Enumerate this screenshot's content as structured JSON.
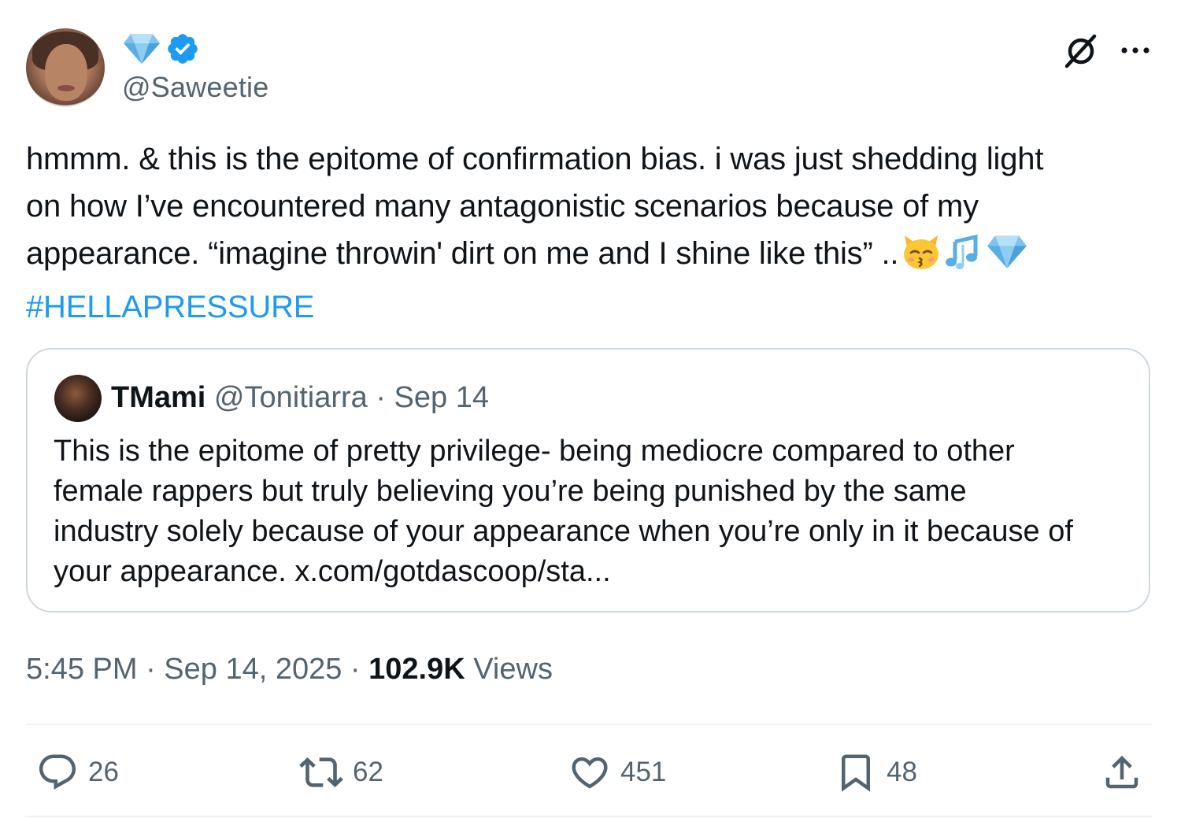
{
  "author": {
    "handle": "@Saweetie",
    "badges": [
      "diamond-icon",
      "verified-icon"
    ]
  },
  "tweet": {
    "lines": [
      "hmmm. & this is the epitome of confirmation bias. i was just shedding light",
      "on how I’ve encountered many antagonistic scenarios because of my",
      "appearance. “imagine throwin' dirt on me and I shine like this” .."
    ],
    "emojis": [
      "kissing-cat-icon",
      "music-notes-icon",
      "gem-icon"
    ],
    "hashtag": "#HELLAPRESSURE"
  },
  "quote": {
    "name": "TMami",
    "meta": "@Tonitiarra · Sep 14",
    "lines": [
      "This is the epitome of pretty privilege- being mediocre compared to other",
      "female rappers but truly believing you’re being punished by the same",
      "industry solely because of your appearance when you’re only in it because of",
      "your appearance. x.com/gotdascoop/sta..."
    ]
  },
  "timestamp": "5:45 PM · Sep 14, 2025 · ",
  "views": {
    "count": "102.9K",
    "label": " Views"
  },
  "actions": {
    "replies": "26",
    "reposts": "62",
    "likes": "451",
    "bookmarks": "48"
  },
  "colors": {
    "accent": "#1d9bf0",
    "text": "#0f1419",
    "muted": "#536471",
    "border": "#cfd9de"
  }
}
